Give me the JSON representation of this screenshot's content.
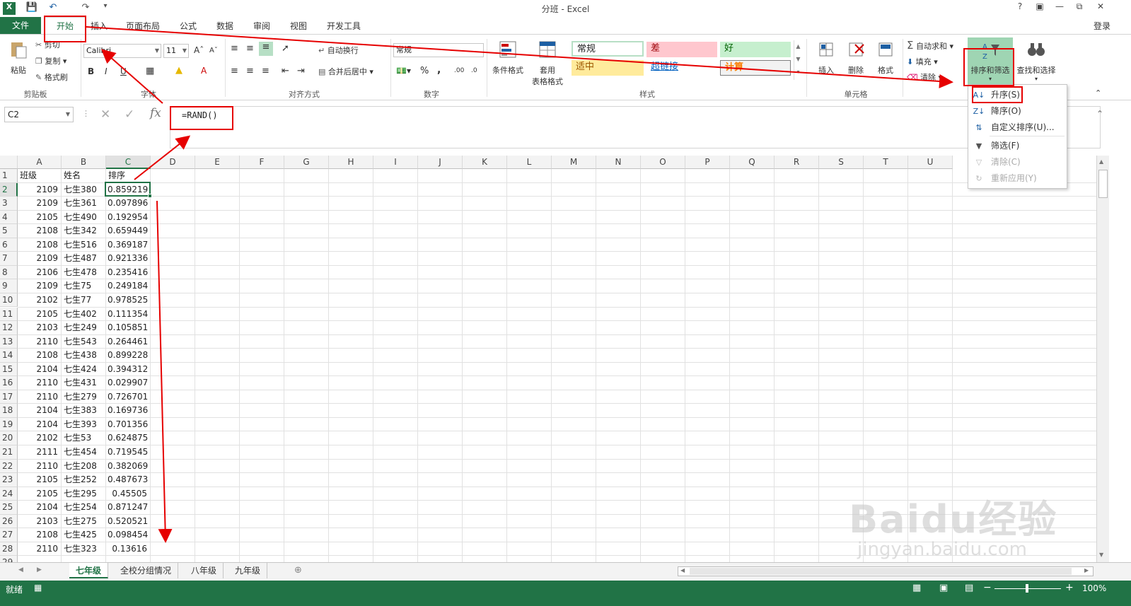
{
  "window": {
    "title": "分班 - Excel",
    "login": "登录",
    "help": "?",
    "quick_access": [
      "save",
      "undo",
      "redo",
      "customize"
    ]
  },
  "tabs": {
    "file": "文件",
    "home": "开始",
    "others": [
      "插入",
      "页面布局",
      "公式",
      "数据",
      "审阅",
      "视图",
      "开发工具"
    ]
  },
  "ribbon": {
    "clipboard": {
      "paste": "粘贴",
      "cut": "剪切",
      "copy": "复制",
      "format_painter": "格式刷",
      "label": "剪贴板"
    },
    "font": {
      "name": "Calibri",
      "size": "11",
      "label": "字体",
      "bold": "B",
      "italic": "I",
      "underline": "U"
    },
    "alignment": {
      "wrap": "自动换行",
      "merge": "合并后居中",
      "label": "对齐方式"
    },
    "number": {
      "format": "常规",
      "percent": "%",
      "comma": ",",
      "label": "数字"
    },
    "styles": {
      "conditional": "条件格式",
      "table_format_1": "套用",
      "table_format_2": "表格格式",
      "normal": "常规",
      "bad": "差",
      "good": "好",
      "neutral": "适中",
      "hyperlink": "超链接",
      "calc": "计算",
      "label": "样式"
    },
    "cells": {
      "insert": "插入",
      "delete": "删除",
      "format": "格式",
      "label": "单元格"
    },
    "editing": {
      "autosum": "自动求和",
      "fill": "填充",
      "clear": "清除",
      "sort_filter": "排序和筛选",
      "find_select": "查找和选择"
    }
  },
  "sort_menu": {
    "items": [
      {
        "label": "升序(S)",
        "enabled": true
      },
      {
        "label": "降序(O)",
        "enabled": true
      },
      {
        "label": "自定义排序(U)...",
        "enabled": true
      },
      {
        "label": "筛选(F)",
        "enabled": true
      },
      {
        "label": "清除(C)",
        "enabled": false
      },
      {
        "label": "重新应用(Y)",
        "enabled": false
      }
    ]
  },
  "formula_bar": {
    "name_box": "C2",
    "formula": "=RAND()"
  },
  "sheet": {
    "columns": [
      "A",
      "B",
      "C",
      "D",
      "E",
      "F",
      "G",
      "H",
      "I",
      "J",
      "K",
      "L",
      "M",
      "N",
      "O",
      "P",
      "Q",
      "R",
      "S",
      "T",
      "U"
    ],
    "header_row": [
      "班级",
      "姓名",
      "排序"
    ],
    "rows": [
      [
        "2109",
        "七生380",
        "0.859219"
      ],
      [
        "2109",
        "七生361",
        "0.097896"
      ],
      [
        "2105",
        "七生490",
        "0.192954"
      ],
      [
        "2108",
        "七生342",
        "0.659449"
      ],
      [
        "2108",
        "七生516",
        "0.369187"
      ],
      [
        "2109",
        "七生487",
        "0.921336"
      ],
      [
        "2106",
        "七生478",
        "0.235416"
      ],
      [
        "2109",
        "七生75",
        "0.249184"
      ],
      [
        "2102",
        "七生77",
        "0.978525"
      ],
      [
        "2105",
        "七生402",
        "0.111354"
      ],
      [
        "2103",
        "七生249",
        "0.105851"
      ],
      [
        "2110",
        "七生543",
        "0.264461"
      ],
      [
        "2108",
        "七生438",
        "0.899228"
      ],
      [
        "2104",
        "七生424",
        "0.394312"
      ],
      [
        "2110",
        "七生431",
        "0.029907"
      ],
      [
        "2110",
        "七生279",
        "0.726701"
      ],
      [
        "2104",
        "七生383",
        "0.169736"
      ],
      [
        "2104",
        "七生393",
        "0.701356"
      ],
      [
        "2102",
        "七生53",
        "0.624875"
      ],
      [
        "2111",
        "七生454",
        "0.719545"
      ],
      [
        "2110",
        "七生208",
        "0.382069"
      ],
      [
        "2105",
        "七生252",
        "0.487673"
      ],
      [
        "2105",
        "七生295",
        "0.45505"
      ],
      [
        "2104",
        "七生254",
        "0.871247"
      ],
      [
        "2103",
        "七生275",
        "0.520521"
      ],
      [
        "2108",
        "七生425",
        "0.098454"
      ],
      [
        "2110",
        "七生323",
        "0.13616"
      ]
    ]
  },
  "sheet_tabs": [
    "七年级",
    "全校分组情况",
    "八年级",
    "九年级"
  ],
  "status": {
    "ready": "就绪",
    "zoom": "100%"
  },
  "watermark": {
    "line1": "Baidu经验",
    "line2": "jingyan.baidu.com"
  },
  "colors": {
    "excel_green": "#217346",
    "highlight_red": "#e60000"
  }
}
